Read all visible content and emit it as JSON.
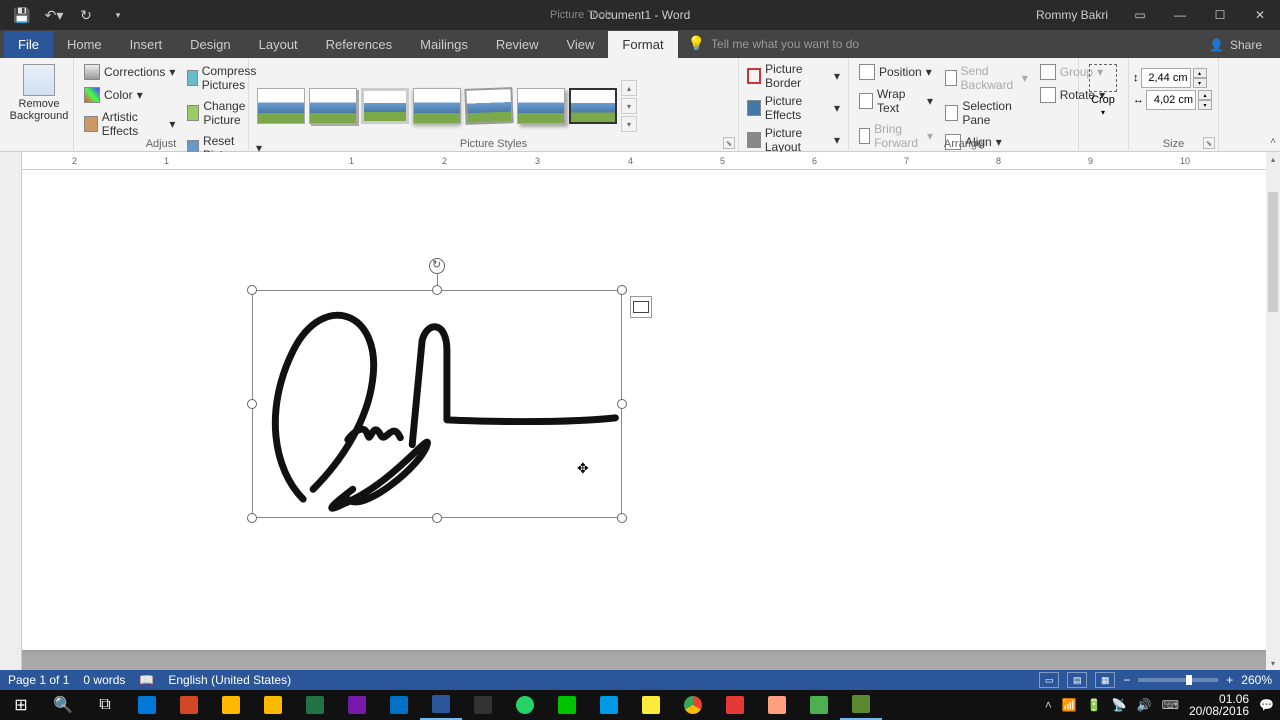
{
  "titlebar": {
    "doc_title": "Document1 - Word",
    "context": "Picture Tools",
    "user": "Rommy Bakri"
  },
  "tabs": {
    "file": "File",
    "home": "Home",
    "insert": "Insert",
    "design": "Design",
    "layout": "Layout",
    "references": "References",
    "mailings": "Mailings",
    "review": "Review",
    "view": "View",
    "format": "Format",
    "tellme": "Tell me what you want to do",
    "share": "Share"
  },
  "ribbon": {
    "remove_bg": "Remove\nBackground",
    "adjust": {
      "label": "Adjust",
      "corrections": "Corrections",
      "color": "Color",
      "artistic": "Artistic Effects",
      "compress": "Compress Pictures",
      "change": "Change Picture",
      "reset": "Reset Picture"
    },
    "picture_styles": {
      "label": "Picture Styles",
      "border": "Picture Border",
      "effects": "Picture Effects",
      "layout": "Picture Layout"
    },
    "arrange": {
      "label": "Arrange",
      "position": "Position",
      "wrap": "Wrap Text",
      "forward": "Bring Forward",
      "backward": "Send Backward",
      "selection": "Selection Pane",
      "align": "Align",
      "group": "Group",
      "rotate": "Rotate"
    },
    "size": {
      "label": "Size",
      "crop": "Crop",
      "height": "2,44 cm",
      "width": "4,02 cm"
    }
  },
  "ruler": {
    "marks": [
      "2",
      "1",
      "1",
      "2",
      "3",
      "4",
      "5",
      "6",
      "7",
      "8",
      "9",
      "10"
    ]
  },
  "status": {
    "page": "Page 1 of 1",
    "words": "0 words",
    "lang": "English (United States)",
    "zoom": "260%"
  },
  "clock": {
    "time": "01.06",
    "date": "20/08/2016"
  }
}
